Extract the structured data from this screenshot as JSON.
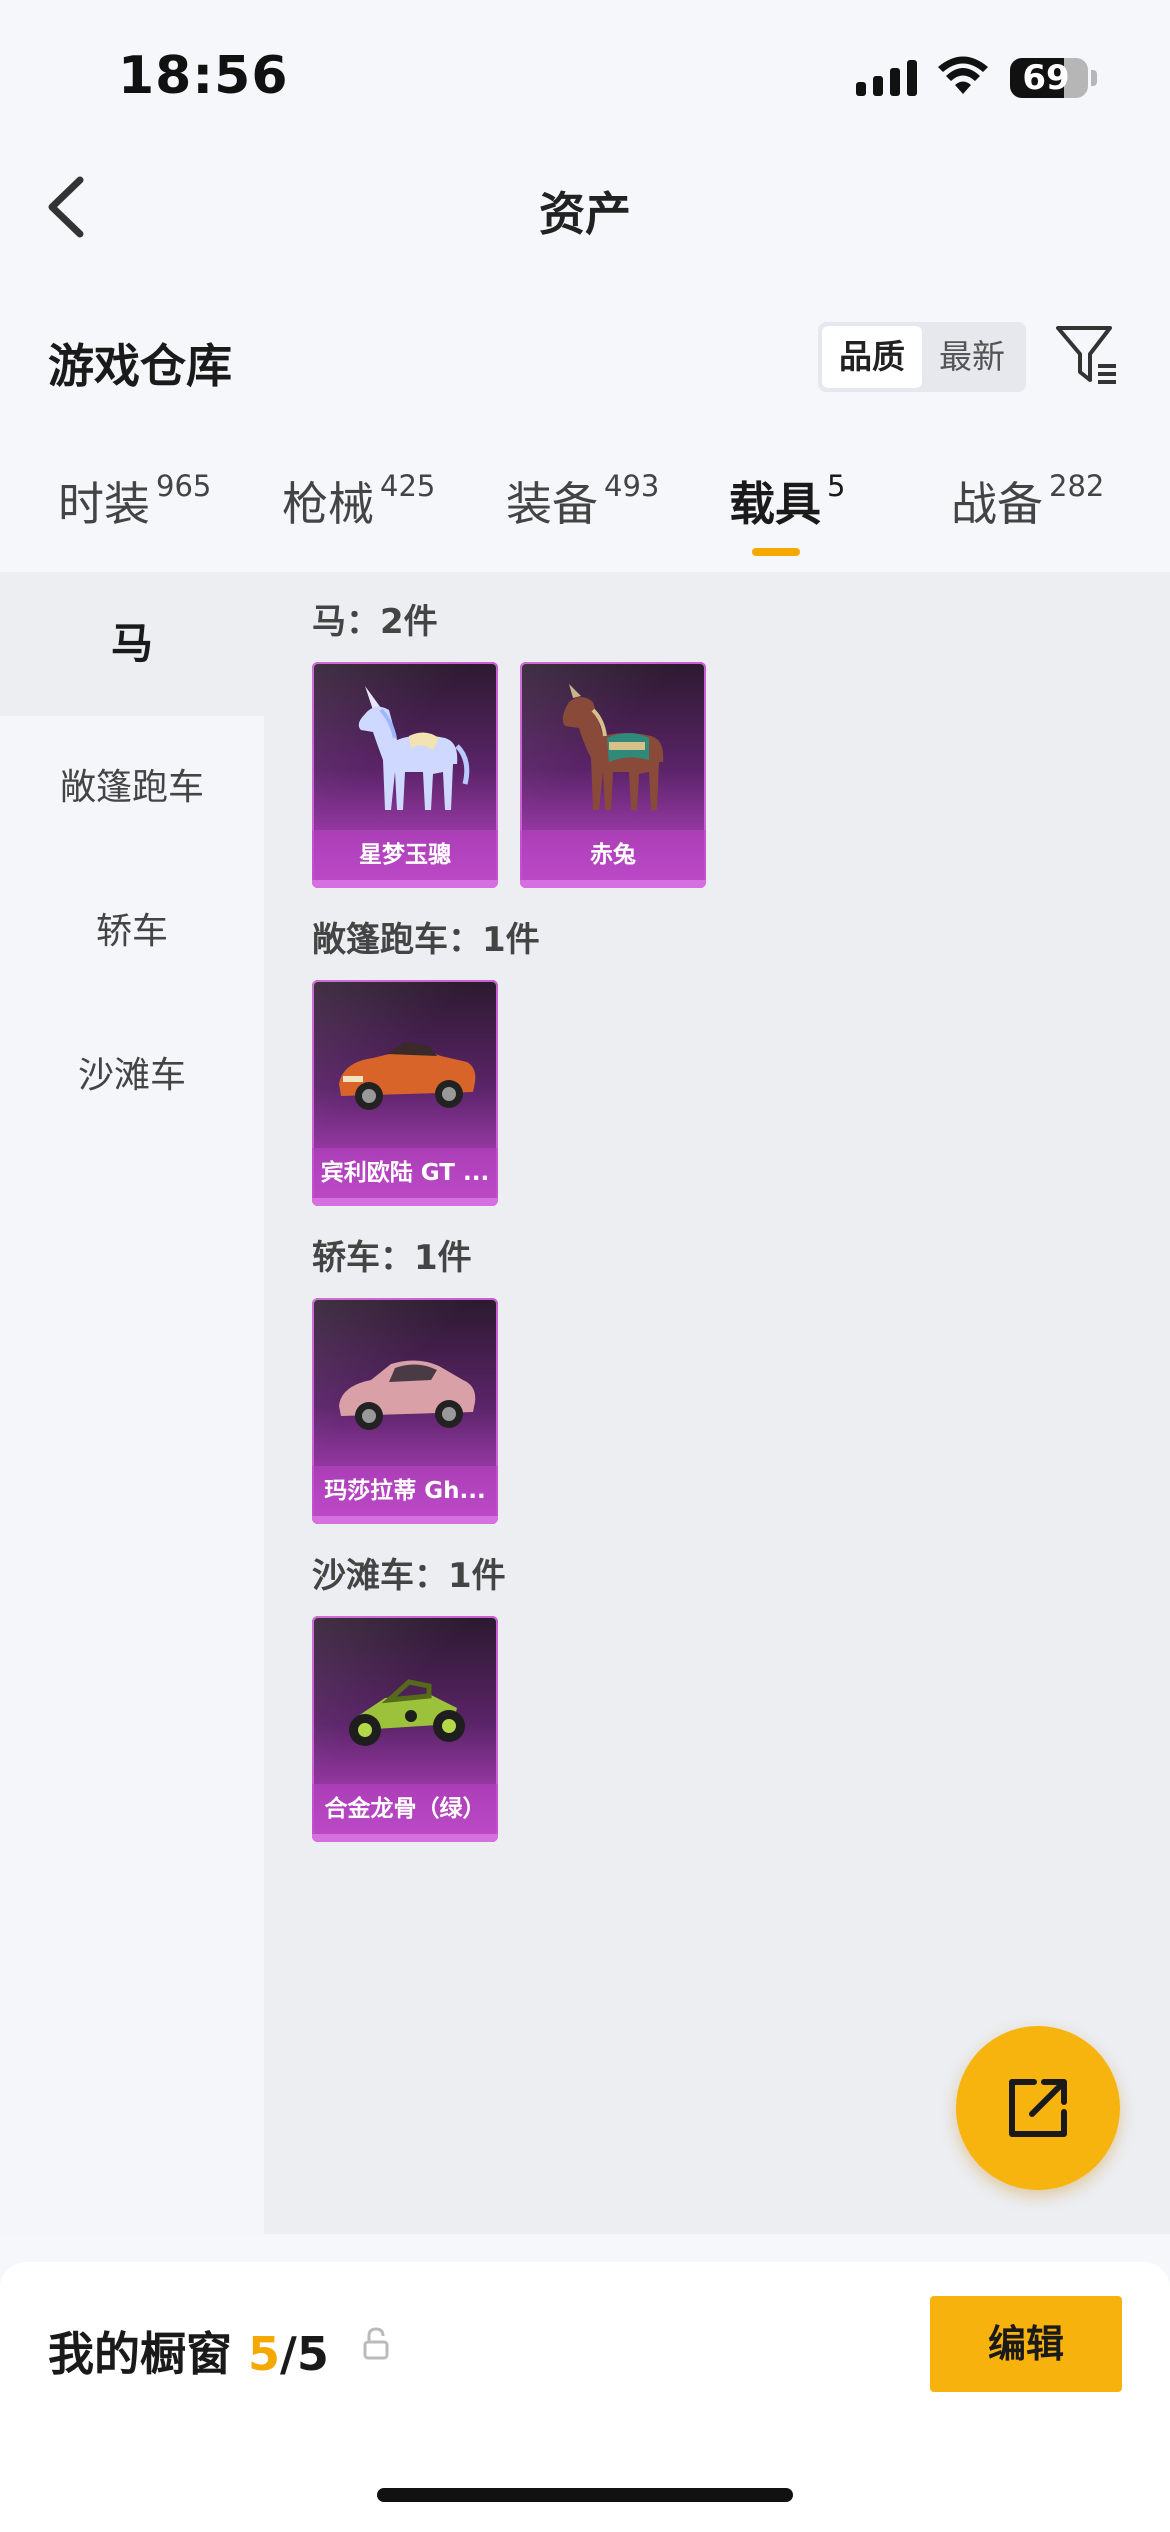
{
  "status_bar": {
    "time": "18:56",
    "battery": "69",
    "battery_level": 0.69
  },
  "nav": {
    "title": "资产",
    "back_icon": "chevron-left-icon"
  },
  "warehouse": {
    "title": "游戏仓库",
    "sort_options": [
      "品质",
      "最新"
    ],
    "active_sort": "品质",
    "filter_icon": "filter-icon"
  },
  "tabs": [
    {
      "label": "时装",
      "count": "965",
      "active": false
    },
    {
      "label": "枪械",
      "count": "425",
      "active": false
    },
    {
      "label": "装备",
      "count": "493",
      "active": false
    },
    {
      "label": "载具",
      "count": "5",
      "active": true
    },
    {
      "label": "战备",
      "count": "282",
      "active": false
    }
  ],
  "side_categories": [
    {
      "label": "马",
      "active": true
    },
    {
      "label": "敞篷跑车",
      "active": false
    },
    {
      "label": "轿车",
      "active": false
    },
    {
      "label": "沙滩车",
      "active": false
    }
  ],
  "sections": [
    {
      "title": "马：2件",
      "items": [
        {
          "name": "星梦玉骢",
          "art": "unicorn"
        },
        {
          "name": "赤兔",
          "art": "armored-horse"
        }
      ]
    },
    {
      "title": "敞篷跑车：1件",
      "items": [
        {
          "name": "宾利欧陆 GT ...",
          "art": "orange-convertible"
        }
      ]
    },
    {
      "title": "轿车：1件",
      "items": [
        {
          "name": "玛莎拉蒂 Gh...",
          "art": "pink-sedan"
        }
      ]
    },
    {
      "title": "沙滩车：1件",
      "items": [
        {
          "name": "合金龙骨（绿）",
          "art": "green-buggy"
        }
      ]
    }
  ],
  "fab_icon": "share-icon",
  "showcase": {
    "label": "我的橱窗",
    "current": "5",
    "sep": "/",
    "total": "5",
    "lock_icon": "lock-icon"
  },
  "edit_label": "编辑",
  "colors": {
    "accent": "#f5a800",
    "card_purple": "#9b3aa8"
  }
}
